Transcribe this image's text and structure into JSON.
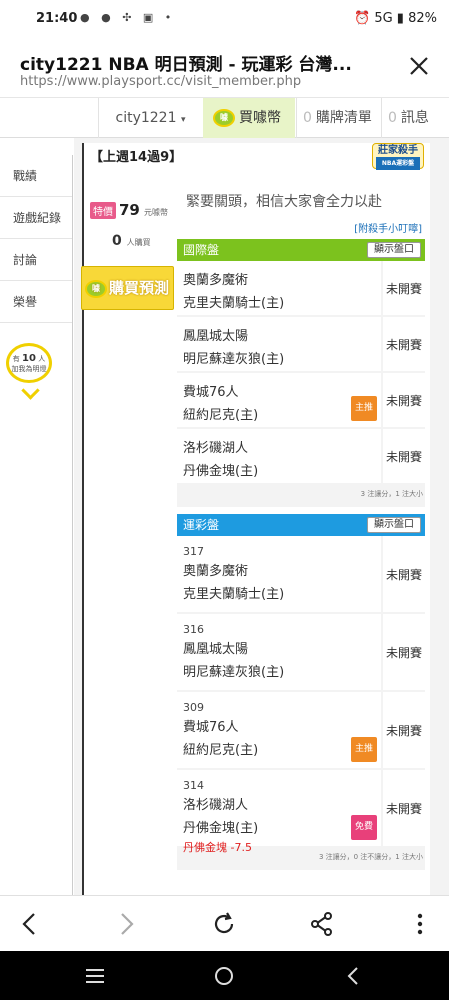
{
  "status": {
    "time": "21:40",
    "right": "82%"
  },
  "browser": {
    "title": "city1221 NBA 明日預測 - 玩運彩 台灣...",
    "url": "https://www.playsport.cc/visit_member.php"
  },
  "topnav": {
    "user": "city1221",
    "buy": "買噱幣",
    "cart_count": "0",
    "cart": "購牌清單",
    "msg_count": "0",
    "msg": "訊息"
  },
  "sidebar": {
    "items": [
      "戰績",
      "遊戲紀錄",
      "討論",
      "榮譽"
    ],
    "fans_prefix": "有",
    "fans_count": "10",
    "fans_suffix": "人",
    "fans_note": "加我為明燈"
  },
  "profile": {
    "record": "【上週14過9】",
    "badge_title": "莊家殺手",
    "badge_sub": "NBA運彩盤",
    "tag": "特價",
    "price": "79",
    "price_unit": "元噱幣",
    "buyers": "0",
    "buyers_unit": "人購買",
    "buy_button": "購買預測",
    "slogan": "緊要關頭，相信大家會全力以赴",
    "tip": "[附殺手小叮嚀]"
  },
  "intl": {
    "title": "國際盤",
    "show_btn": "顯示盤口",
    "color": "#7cc21e",
    "rows": [
      {
        "away": "奧蘭多魔術",
        "home": "克里夫蘭騎士(主)",
        "status": "未開賽",
        "chip": ""
      },
      {
        "away": "鳳凰城太陽",
        "home": "明尼蘇達灰狼(主)",
        "status": "未開賽",
        "chip": ""
      },
      {
        "away": "費城76人",
        "home": "紐約尼克(主)",
        "status": "未開賽",
        "chip": "主推"
      },
      {
        "away": "洛杉磯湖人",
        "home": "丹佛金塊(主)",
        "status": "未開賽",
        "chip": ""
      }
    ],
    "footer": "3 注讓分，1 注大小"
  },
  "sports": {
    "title": "運彩盤",
    "show_btn": "顯示盤口",
    "color": "#1e9be0",
    "rows": [
      {
        "num": "317",
        "away": "奧蘭多魔術",
        "home": "克里夫蘭騎士(主)",
        "status": "未開賽",
        "chip": "",
        "pick": ""
      },
      {
        "num": "316",
        "away": "鳳凰城太陽",
        "home": "明尼蘇達灰狼(主)",
        "status": "未開賽",
        "chip": "",
        "pick": ""
      },
      {
        "num": "309",
        "away": "費城76人",
        "home": "紐約尼克(主)",
        "status": "未開賽",
        "chip": "主推",
        "pick": ""
      },
      {
        "num": "314",
        "away": "洛杉磯湖人",
        "home": "丹佛金塊(主)",
        "status": "未開賽",
        "chip": "免費",
        "pick": "丹佛金塊 -7.5"
      }
    ],
    "footer": "3 注讓分，0 注不讓分，1 注大小"
  },
  "colors": {
    "chip_main": "#f08a24",
    "chip_free": "#e8407a",
    "accent_yellow": "#f8d838"
  }
}
